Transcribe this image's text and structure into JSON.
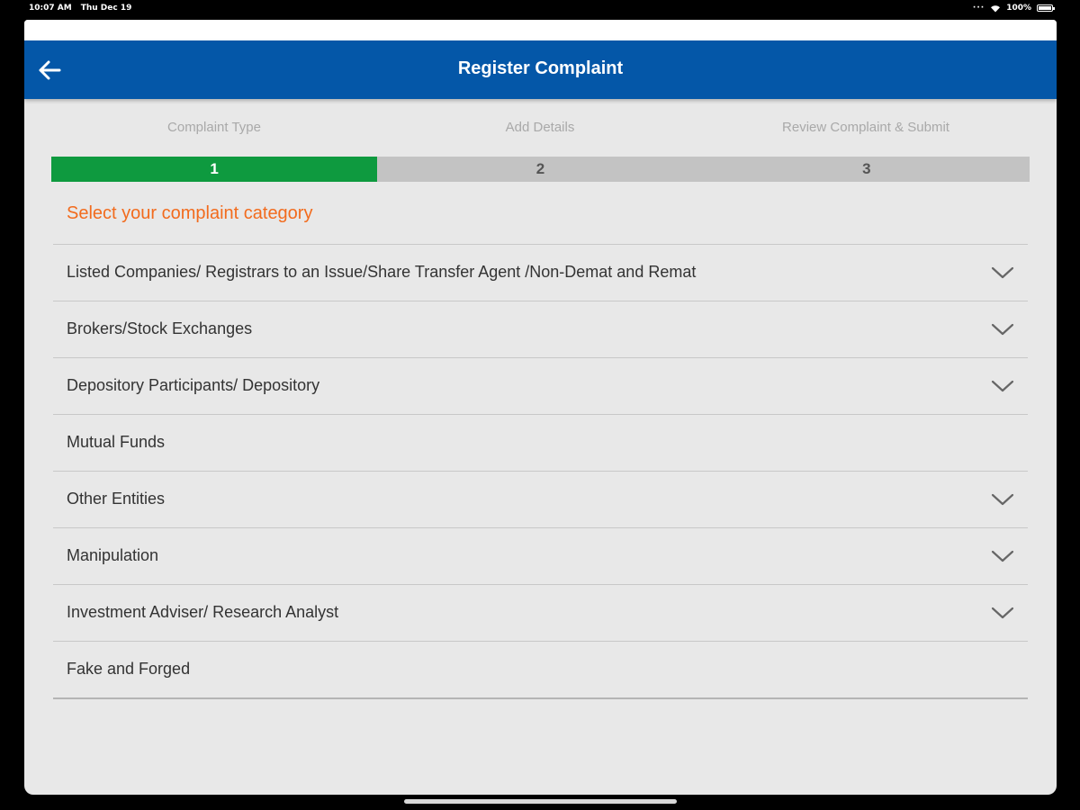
{
  "status_bar": {
    "time": "10:07 AM",
    "date": "Thu Dec 19",
    "battery": "100%",
    "icons": [
      "wifi-icon",
      "battery-icon"
    ]
  },
  "app_bar": {
    "title": "Register Complaint",
    "back_icon": "arrow-left-icon",
    "background": "#0457a8"
  },
  "steps": {
    "labels": [
      "Complaint Type",
      "Add Details",
      "Review Complaint & Submit"
    ],
    "numbers": [
      "1",
      "2",
      "3"
    ],
    "active_step": 1,
    "active_color": "#0e9a3f",
    "inactive_color": "#c3c3c3"
  },
  "section": {
    "heading": "Select your complaint category",
    "heading_color": "#f26b1d"
  },
  "categories": [
    {
      "label": "Listed Companies/ Registrars to an Issue/Share Transfer Agent /Non-Demat and Remat",
      "expandable": true
    },
    {
      "label": "Brokers/Stock Exchanges",
      "expandable": true
    },
    {
      "label": "Depository Participants/ Depository",
      "expandable": true
    },
    {
      "label": "Mutual Funds",
      "expandable": false
    },
    {
      "label": "Other Entities",
      "expandable": true
    },
    {
      "label": "Manipulation",
      "expandable": true
    },
    {
      "label": "Investment Adviser/ Research Analyst",
      "expandable": true
    },
    {
      "label": "Fake and Forged",
      "expandable": false
    }
  ]
}
